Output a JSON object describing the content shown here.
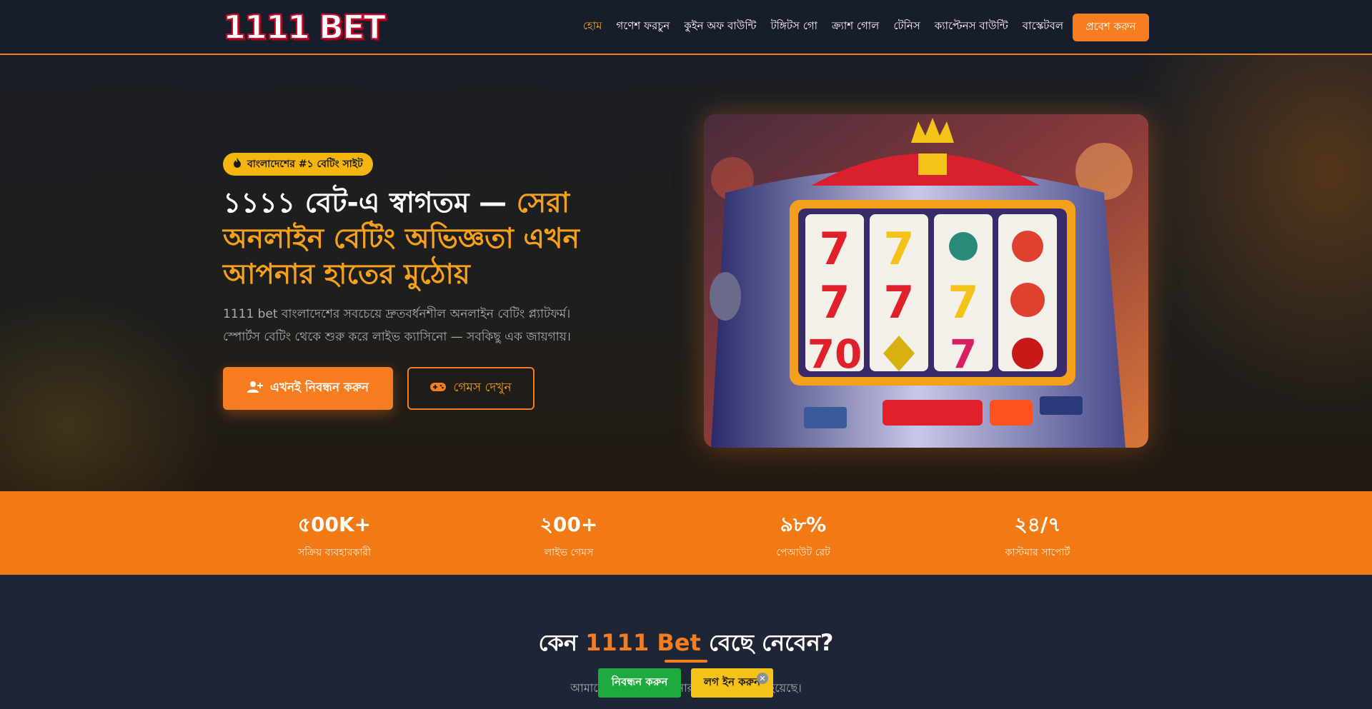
{
  "header": {
    "logo_text": "1111 BET",
    "nav": [
      {
        "label": "হোম",
        "active": true
      },
      {
        "label": "গণেশ ফরচুন"
      },
      {
        "label": "কুইন অফ বাউন্টি"
      },
      {
        "label": "টঙ্গিটস গো"
      },
      {
        "label": "ক্র্যাশ গোল"
      },
      {
        "label": "টেনিস"
      },
      {
        "label": "ক্যাপ্টেনস বাউন্টি"
      },
      {
        "label": "বাস্কেটবল"
      }
    ],
    "login_label": "প্রবেশ করুন"
  },
  "hero": {
    "badge": "বাংলাদেশের #১ বেটিং সাইট",
    "badge_icon": "flame-icon",
    "title_plain": "১১১১ বেট-এ স্বাগতম — ",
    "title_accent": "সেরা অনলাইন বেটিং অভিজ্ঞতা এখন আপনার হাতের মুঠোয়",
    "desc_line1": "1111 bet বাংলাদেশের সবচেয়ে দ্রুতবর্ধনশীল অনলাইন বেটিং প্ল্যাটফর্ম।",
    "desc_line2": "স্পোর্টস বেটিং থেকে শুরু করে লাইভ ক্যাসিনো — সবকিছু এক জায়গায়।",
    "primary_button": "এখনই নিবন্ধন করুন",
    "primary_icon": "user-plus-icon",
    "secondary_button": "গেমস দেখুন",
    "secondary_icon": "gamepad-icon"
  },
  "stats": [
    {
      "value": "৫00K+",
      "label": "সক্রিয় ব্যবহারকারী"
    },
    {
      "value": "২00+",
      "label": "লাইভ গেমস"
    },
    {
      "value": "৯৮%",
      "label": "পেআউট রেট"
    },
    {
      "value": "২৪/৭",
      "label": "কাস্টমার সাপোর্ট"
    }
  ],
  "why": {
    "title_pre": "কেন ",
    "title_accent": "1111 Bet",
    "title_post": " বেছে নেবেন?",
    "desc": "আমাদের প্ল্যাটফর্ম ব্য... নার জন্য তৈরি করা হয়েছে।"
  },
  "floating_bar": {
    "register_label": "নিবন্ধন করুন",
    "login_label": "লগ ইন করুন",
    "close_label": "✕"
  },
  "colors": {
    "accent": "#f57c1f",
    "gold": "#f5b50f",
    "green": "#1faa3f",
    "background": "#1b2130"
  }
}
